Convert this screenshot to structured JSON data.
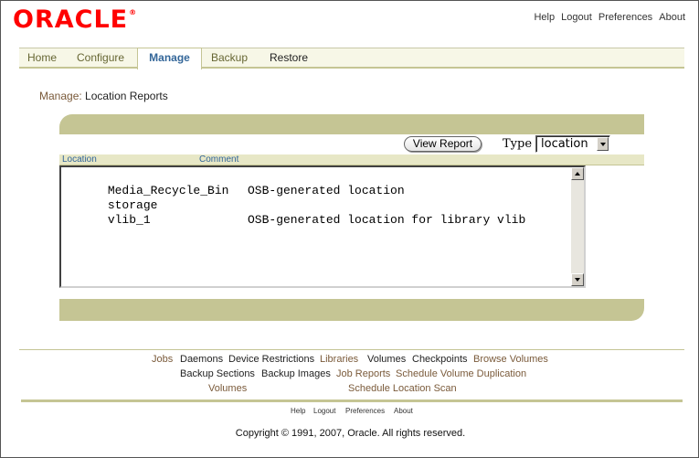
{
  "brand": {
    "logo_text": "ORACLE",
    "trademark": "®",
    "logo_color": "#ff0000"
  },
  "global_links": {
    "help": "Help",
    "logout": "Logout",
    "preferences": "Preferences",
    "about": "About"
  },
  "tabs": [
    {
      "label": "Home"
    },
    {
      "label": "Configure"
    },
    {
      "label": "Manage",
      "active": true
    },
    {
      "label": "Backup"
    },
    {
      "label": "Restore"
    }
  ],
  "breadcrumb": {
    "parent": "Manage:",
    "current": "Location Reports"
  },
  "report": {
    "view_button": "View Report",
    "type_label": "Type",
    "type_value": "location",
    "columns": {
      "location": "Location",
      "comment": "Comment"
    },
    "rows": [
      {
        "location": "Media_Recycle_Bin",
        "comment": "OSB-generated location"
      },
      {
        "location": "storage",
        "comment": ""
      },
      {
        "location": "vlib_1",
        "comment": "OSB-generated location for library vlib"
      }
    ]
  },
  "footer_nav": {
    "line1": [
      "Jobs",
      "Daemons",
      "Device Restrictions",
      "Libraries",
      "Volumes",
      "Checkpoints",
      "Browse Volumes"
    ],
    "line2": [
      "Backup Sections",
      "Backup Images",
      "Job Reports",
      "Schedule Volume Duplication"
    ],
    "line3": [
      "Volumes",
      "Schedule Location Scan"
    ]
  },
  "footer_mini": {
    "help": "Help",
    "logout": "Logout",
    "preferences": "Preferences",
    "about": "About"
  },
  "copyright": "Copyright © 1991, 2007, Oracle. All rights reserved.",
  "colors": {
    "band": "#c5c594",
    "active_tab_text": "#336699",
    "link_brown": "#7a5a3a"
  }
}
